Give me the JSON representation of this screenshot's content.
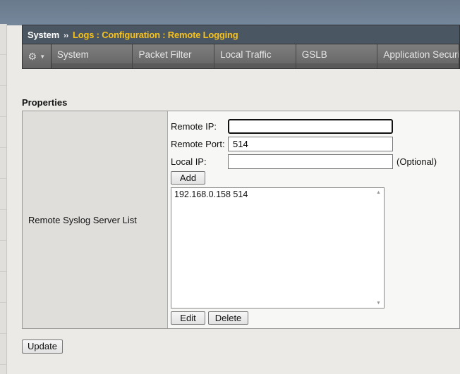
{
  "breadcrumb": {
    "root": "System",
    "separator": "››",
    "path": "Logs : Configuration : Remote Logging"
  },
  "nav": {
    "tabs": [
      "System",
      "Packet Filter",
      "Local Traffic",
      "GSLB",
      "Application Security"
    ]
  },
  "section": {
    "title": "Properties"
  },
  "property": {
    "label": "Remote Syslog Server List",
    "remote_ip_label": "Remote IP:",
    "remote_ip_value": "",
    "remote_port_label": "Remote Port:",
    "remote_port_value": "514",
    "local_ip_label": "Local IP:",
    "local_ip_value": "",
    "local_ip_hint": "(Optional)",
    "add_label": "Add",
    "servers": [
      "192.168.0.158 514"
    ],
    "edit_label": "Edit",
    "delete_label": "Delete"
  },
  "update_label": "Update"
}
